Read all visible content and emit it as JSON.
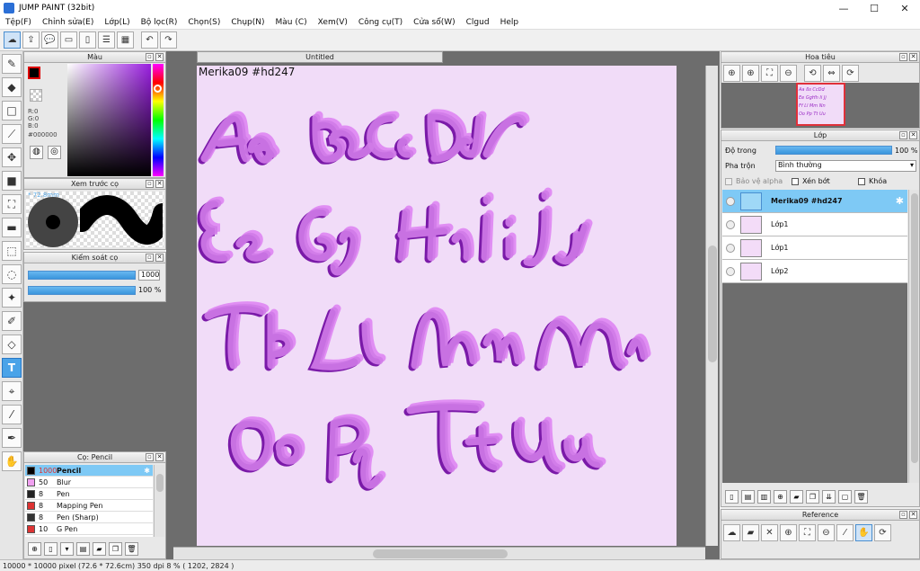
{
  "window": {
    "title": "JUMP PAINT (32bit)",
    "minimize": "—",
    "maximize": "☐",
    "close": "✕"
  },
  "menu": [
    "Tệp(F)",
    "Chỉnh sửa(E)",
    "Lớp(L)",
    "Bộ lọc(R)",
    "Chọn(S)",
    "Chụp(N)",
    "Màu (C)",
    "Xem(V)",
    "Công cụ(T)",
    "Cửa sổ(W)",
    "Clgud",
    "Help"
  ],
  "toolbar_icons": [
    "cloud-icon",
    "share-icon",
    "comment-icon",
    "comment-alt-icon",
    "page-icon",
    "settings-list-icon",
    "grid-icon",
    "undo-icon",
    "redo-icon"
  ],
  "tools": [
    "brush-icon",
    "eraser-icon",
    "rect-select-icon",
    "line-icon",
    "move-icon",
    "fill-rect-icon",
    "bucket-icon",
    "gradient-icon",
    "marquee-icon",
    "lasso-icon",
    "magic-wand-icon",
    "pen-select-icon",
    "select-eraser-icon",
    "text-icon",
    "hand-lasso-icon",
    "eyedropper-icon",
    "pen-icon",
    "hand-icon"
  ],
  "color_panel": {
    "title": "Màu",
    "fg": "#000000",
    "r": "R:0",
    "g": "G:0",
    "b": "B:0",
    "hex": "#000000"
  },
  "brush_preview": {
    "title": "Xem trước cọ",
    "size_label": "* 72.8mm"
  },
  "brush_control": {
    "title": "Kiểm soát cọ",
    "size": "1000",
    "opacity": "100 %"
  },
  "brush_list": {
    "title": "Cọ: Pencil",
    "items": [
      {
        "size": "1000",
        "name": "Pencil",
        "color": "#000000",
        "selected": true
      },
      {
        "size": "50",
        "name": "Blur",
        "color": "#f0a0f0"
      },
      {
        "size": "8",
        "name": "Pen",
        "color": "#222222"
      },
      {
        "size": "8",
        "name": "Mapping Pen",
        "color": "#dd3333"
      },
      {
        "size": "8",
        "name": "Pen (Sharp)",
        "color": "#333333"
      },
      {
        "size": "10",
        "name": "G Pen",
        "color": "#dd3333"
      }
    ]
  },
  "document": {
    "tab": "Untitled",
    "canvas_text": "Merika09  #hd247",
    "paper_color": "#f1dcf8"
  },
  "navigator": {
    "title": "Hoa tiêu",
    "thumb_lines": [
      "Aa ßs CcDd",
      "Ee GgHh Ii Jj",
      "Ff Ll Mm Nn",
      "Oo Pp Tt Uu"
    ]
  },
  "layers_panel": {
    "title": "Lớp",
    "opacity_label": "Độ trong",
    "opacity_value": "100 %",
    "blend_label": "Pha trộn",
    "blend_value": "Bình thường",
    "protect_alpha": "Bảo vệ alpha",
    "clipping": "Xén bớt",
    "lock": "Khóa",
    "layers": [
      {
        "name": "Merika09  #hd247",
        "selected": true
      },
      {
        "name": "Lớp1"
      },
      {
        "name": "Lớp1"
      },
      {
        "name": "Lớp2"
      }
    ]
  },
  "reference": {
    "title": "Reference"
  },
  "status": {
    "text": "10000 * 10000 pixel   (72.6 * 72.6cm)   350 dpi   8 %   ( 1202, 2824 )"
  }
}
